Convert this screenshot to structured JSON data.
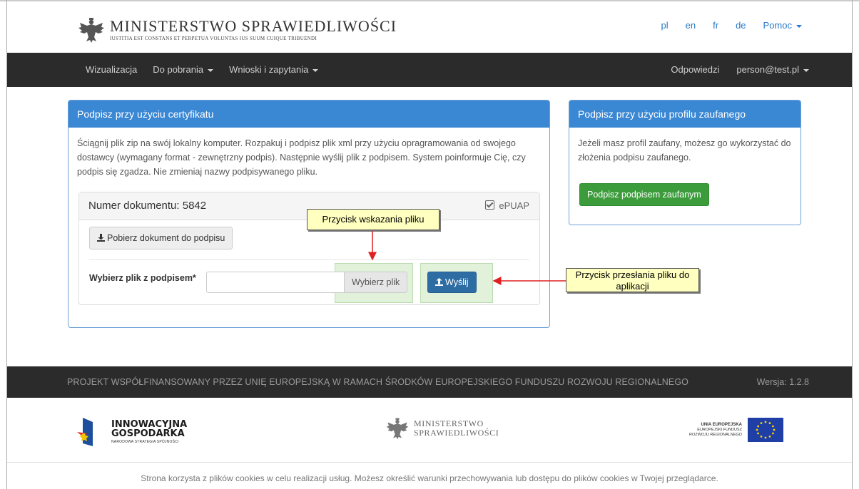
{
  "header": {
    "logo_title": "MINISTERSTWO SPRAWIEDLIWOŚCI",
    "logo_subtitle": "IUSTITIA EST CONSTANS ET PERPETUA VOLUNTAS IUS SUUM CUIQUE TRIBUENDI",
    "langs": [
      "pl",
      "en",
      "fr",
      "de",
      "Pomoc"
    ]
  },
  "nav": {
    "left": [
      "Wizualizacja",
      "Do pobrania",
      "Wnioski i zapytania"
    ],
    "right": [
      "Odpowiedzi",
      "person@test.pl"
    ]
  },
  "cert_panel": {
    "title": "Podpisz przy użyciu certyfikatu",
    "description": "Ściągnij plik zip na swój lokalny komputer. Rozpakuj i podpisz plik xml przy użyciu opragramowania od swojego dostawcy (wymagany format - zewnętrzny podpis). Następnie wyślij plik z podpisem. System poinformuje Cię, czy podpis się zgadza. Nie zmieniaj nazwy podpisywanego pliku.",
    "doc_number": "Numer dokumentu: 5842",
    "epuap": "ePUAP",
    "download_label": "Pobierz dokument do podpisu",
    "file_label": "Wybierz plik z podpisem*",
    "file_value": "",
    "choose_label": "Wybierz plik",
    "send_label": "Wyślij"
  },
  "trusted_panel": {
    "title": "Podpisz przy użyciu profilu zaufanego",
    "description": "Jeżeli masz profil zaufany, możesz go wykorzystać do złożenia podpisu zaufanego.",
    "button_label": "Podpisz podpisem zaufanym"
  },
  "callouts": {
    "choose": "Przycisk wskazania pliku",
    "send": "Przycisk przesłania pliku do aplikacji"
  },
  "footer": {
    "project": "PROJEKT WSPÓŁFINANSOWANY PRZEZ UNIĘ EUROPEJSKĄ W RAMACH ŚRODKÓW EUROPEJSKIEGO FUNDUSZU ROZWOJU REGIONALNEGO",
    "version": "Wersja: 1.2.8",
    "ig_line1": "INNOWACYJNA",
    "ig_line2": "GOSPODARKA",
    "ig_sub": "NARODOWA STRATEGIA SPÓJNOŚCI",
    "ms_line1": "MINISTERSTWO",
    "ms_line2": "SPRAWIEDLIWOŚCI",
    "ue_line1": "UNIA EUROPEJSKA",
    "ue_line2": "EUROPEJSKI FUNDUSZ",
    "ue_line3": "ROZWOJU REGIONALNEGO",
    "cookie": "Strona korzysta z plików cookies w celu realizacji usług. Możesz określić warunki przechowywania lub dostępu do plików cookies w Twojej przeglądarce."
  },
  "colors": {
    "primary": "#3a87d4",
    "nav": "#2b2b2b",
    "success": "#3c9c3c",
    "callout": "#ffffc0",
    "arrow": "#e02020"
  }
}
